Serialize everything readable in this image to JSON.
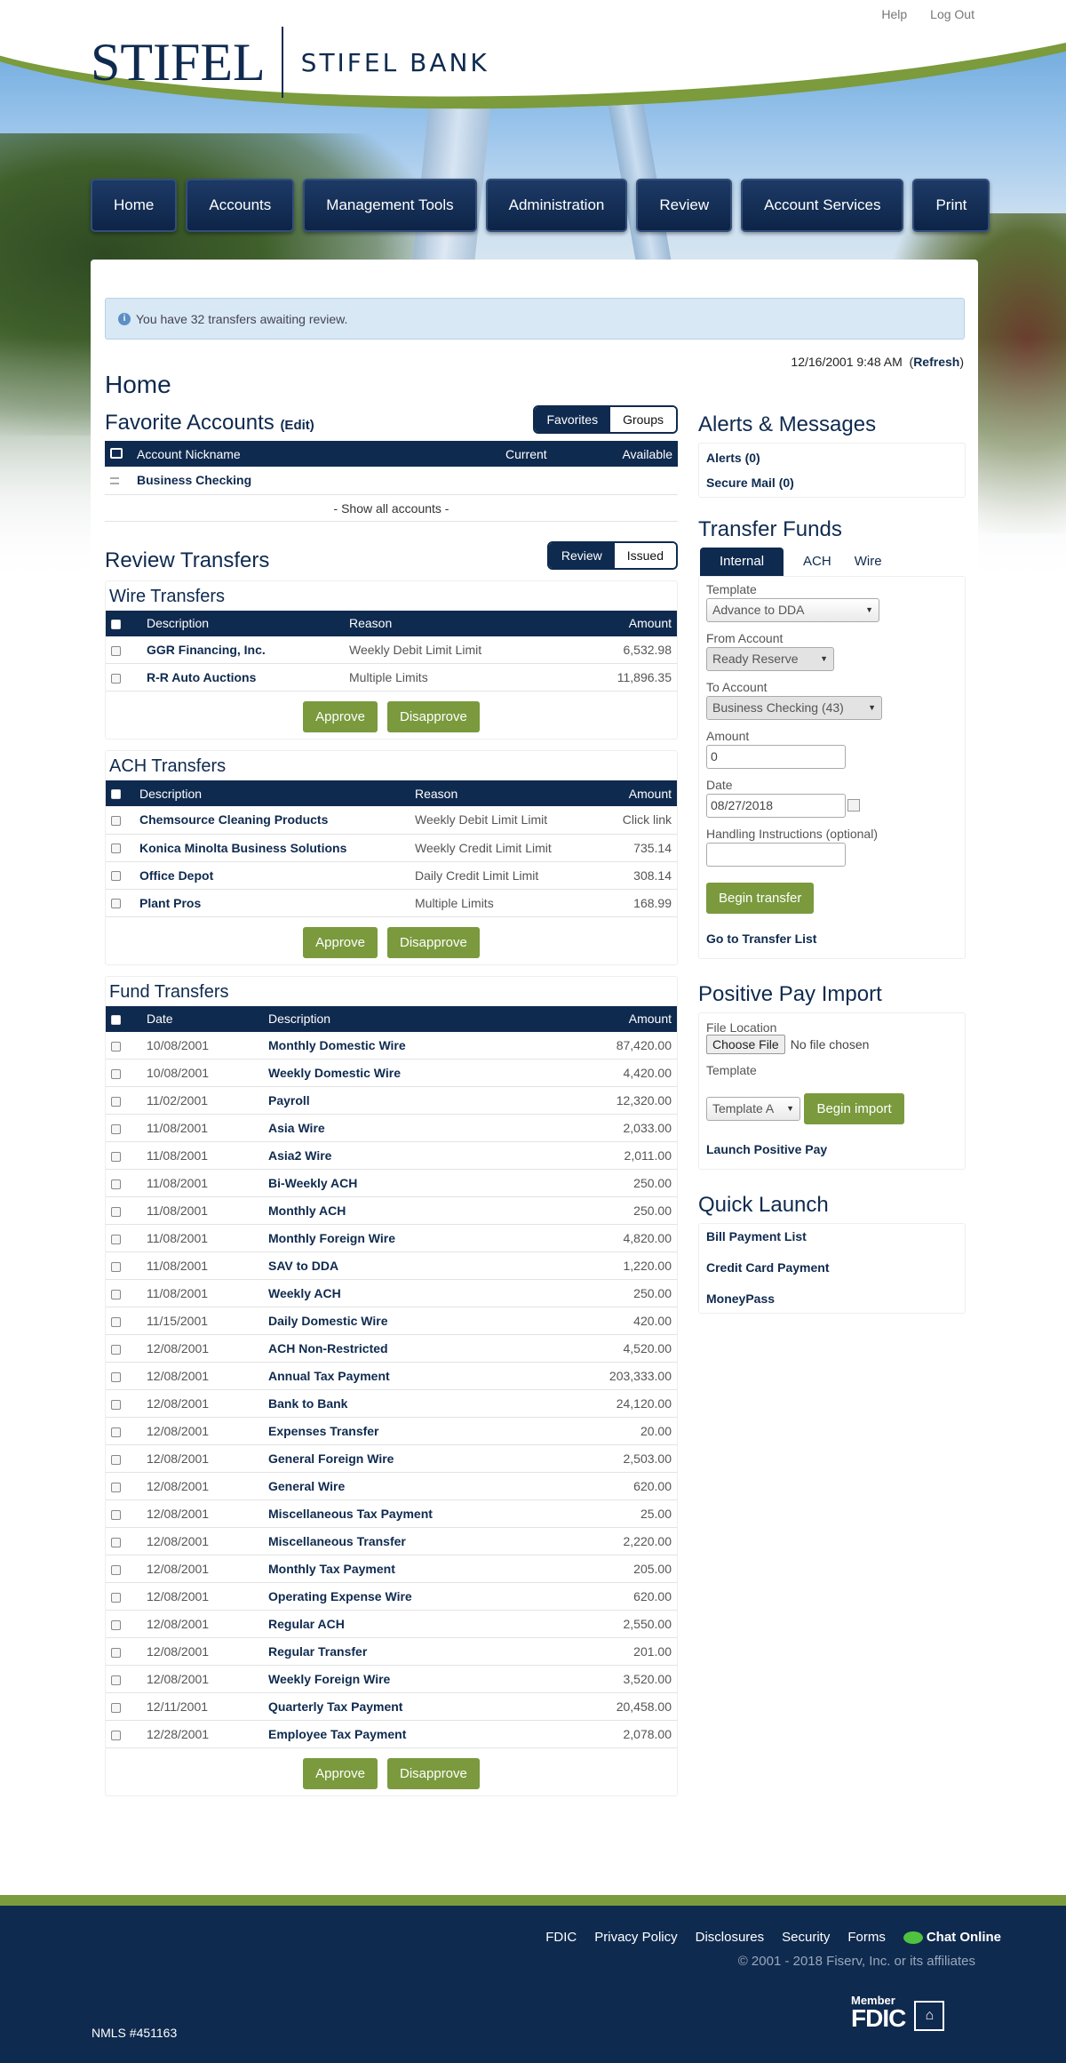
{
  "brand": {
    "name": "STIFEL",
    "sub": "STIFEL BANK"
  },
  "header": {
    "help": "Help",
    "logout": "Log Out"
  },
  "nav": [
    "Home",
    "Accounts",
    "Management Tools",
    "Administration",
    "Review",
    "Account Services",
    "Print"
  ],
  "notice": "You have 32 transfers awaiting review.",
  "timestamp": {
    "date": "12/16/2001 9:48 AM",
    "refresh": "Refresh"
  },
  "page_title": "Home",
  "favorites": {
    "title": "Favorite Accounts",
    "edit": "(Edit)",
    "toggle": [
      "Favorites",
      "Groups"
    ],
    "columns": [
      "Account Nickname",
      "Current",
      "Available"
    ],
    "rows": [
      "Business Checking"
    ],
    "show_all": "- Show all accounts -"
  },
  "review": {
    "title": "Review Transfers",
    "toggle": [
      "Review",
      "Issued"
    ]
  },
  "wire": {
    "title": "Wire Transfers",
    "columns": [
      "Description",
      "Reason",
      "Amount"
    ],
    "rows": [
      {
        "desc": "GGR Financing, Inc.",
        "reason": "Weekly Debit Limit Limit",
        "amount": "6,532.98"
      },
      {
        "desc": "R-R Auto Auctions",
        "reason": "Multiple Limits",
        "amount": "11,896.35"
      }
    ]
  },
  "ach": {
    "title": "ACH Transfers",
    "columns": [
      "Description",
      "Reason",
      "Amount"
    ],
    "rows": [
      {
        "desc": "Chemsource Cleaning Products",
        "reason": "Weekly Debit Limit Limit",
        "amount": "Click link"
      },
      {
        "desc": "Konica Minolta Business Solutions",
        "reason": "Weekly Credit Limit Limit",
        "amount": "735.14"
      },
      {
        "desc": "Office Depot",
        "reason": "Daily Credit Limit Limit",
        "amount": "308.14"
      },
      {
        "desc": "Plant Pros",
        "reason": "Multiple Limits",
        "amount": "168.99"
      }
    ]
  },
  "fund": {
    "title": "Fund Transfers",
    "columns": [
      "Date",
      "Description",
      "Amount"
    ],
    "rows": [
      {
        "date": "10/08/2001",
        "desc": "Monthly Domestic Wire",
        "amount": "87,420.00"
      },
      {
        "date": "10/08/2001",
        "desc": "Weekly Domestic Wire",
        "amount": "4,420.00"
      },
      {
        "date": "11/02/2001",
        "desc": "Payroll",
        "amount": "12,320.00"
      },
      {
        "date": "11/08/2001",
        "desc": "Asia Wire",
        "amount": "2,033.00"
      },
      {
        "date": "11/08/2001",
        "desc": "Asia2 Wire",
        "amount": "2,011.00"
      },
      {
        "date": "11/08/2001",
        "desc": "Bi-Weekly ACH",
        "amount": "250.00"
      },
      {
        "date": "11/08/2001",
        "desc": "Monthly ACH",
        "amount": "250.00"
      },
      {
        "date": "11/08/2001",
        "desc": "Monthly Foreign Wire",
        "amount": "4,820.00"
      },
      {
        "date": "11/08/2001",
        "desc": "SAV to DDA",
        "amount": "1,220.00"
      },
      {
        "date": "11/08/2001",
        "desc": "Weekly ACH",
        "amount": "250.00"
      },
      {
        "date": "11/15/2001",
        "desc": "Daily Domestic Wire",
        "amount": "420.00"
      },
      {
        "date": "12/08/2001",
        "desc": "ACH Non-Restricted",
        "amount": "4,520.00"
      },
      {
        "date": "12/08/2001",
        "desc": "Annual Tax Payment",
        "amount": "203,333.00"
      },
      {
        "date": "12/08/2001",
        "desc": "Bank to Bank",
        "amount": "24,120.00"
      },
      {
        "date": "12/08/2001",
        "desc": "Expenses Transfer",
        "amount": "20.00"
      },
      {
        "date": "12/08/2001",
        "desc": "General Foreign Wire",
        "amount": "2,503.00"
      },
      {
        "date": "12/08/2001",
        "desc": "General Wire",
        "amount": "620.00"
      },
      {
        "date": "12/08/2001",
        "desc": "Miscellaneous Tax Payment",
        "amount": "25.00"
      },
      {
        "date": "12/08/2001",
        "desc": "Miscellaneous Transfer",
        "amount": "2,220.00"
      },
      {
        "date": "12/08/2001",
        "desc": "Monthly Tax Payment",
        "amount": "205.00"
      },
      {
        "date": "12/08/2001",
        "desc": "Operating Expense Wire",
        "amount": "620.00"
      },
      {
        "date": "12/08/2001",
        "desc": "Regular ACH",
        "amount": "2,550.00"
      },
      {
        "date": "12/08/2001",
        "desc": "Regular Transfer",
        "amount": "201.00"
      },
      {
        "date": "12/08/2001",
        "desc": "Weekly Foreign Wire",
        "amount": "3,520.00"
      },
      {
        "date": "12/11/2001",
        "desc": "Quarterly Tax Payment",
        "amount": "20,458.00"
      },
      {
        "date": "12/28/2001",
        "desc": "Employee Tax Payment",
        "amount": "2,078.00"
      }
    ]
  },
  "buttons": {
    "approve": "Approve",
    "disapprove": "Disapprove"
  },
  "alerts": {
    "title": "Alerts & Messages",
    "alerts": "Alerts (0)",
    "mail": "Secure Mail (0)"
  },
  "transfer_funds": {
    "title": "Transfer Funds",
    "tabs": [
      "Internal",
      "ACH",
      "Wire"
    ],
    "template_label": "Template",
    "template_value": "Advance to DDA",
    "from_label": "From Account",
    "from_value": "Ready Reserve",
    "to_label": "To Account",
    "to_value": "Business Checking (43)",
    "amount_label": "Amount",
    "amount_value": "0",
    "date_label": "Date",
    "date_value": "08/27/2018",
    "handling_label": "Handling Instructions (optional)",
    "handling_value": "",
    "begin": "Begin transfer",
    "list": "Go to Transfer List"
  },
  "positive_pay": {
    "title": "Positive Pay Import",
    "file_label": "File Location",
    "choose": "Choose File",
    "no_file": "No file chosen",
    "template_label": "Template",
    "template_value": "Template A",
    "begin": "Begin import",
    "launch": "Launch Positive Pay"
  },
  "quick_launch": {
    "title": "Quick Launch",
    "items": [
      "Bill Payment List",
      "Credit Card Payment",
      "MoneyPass"
    ]
  },
  "footer": {
    "links": [
      "FDIC",
      "Privacy Policy",
      "Disclosures",
      "Security",
      "Forms"
    ],
    "chat": "Chat Online",
    "copyright": "© 2001 - 2018 Fiserv, Inc. or its affiliates",
    "nmls": "NMLS #451163",
    "member": "Member",
    "fdic": "FDIC"
  },
  "colors": {
    "navy": "#0f2a4f",
    "green": "#7a9a3d",
    "notice": "#d9e8f5"
  }
}
